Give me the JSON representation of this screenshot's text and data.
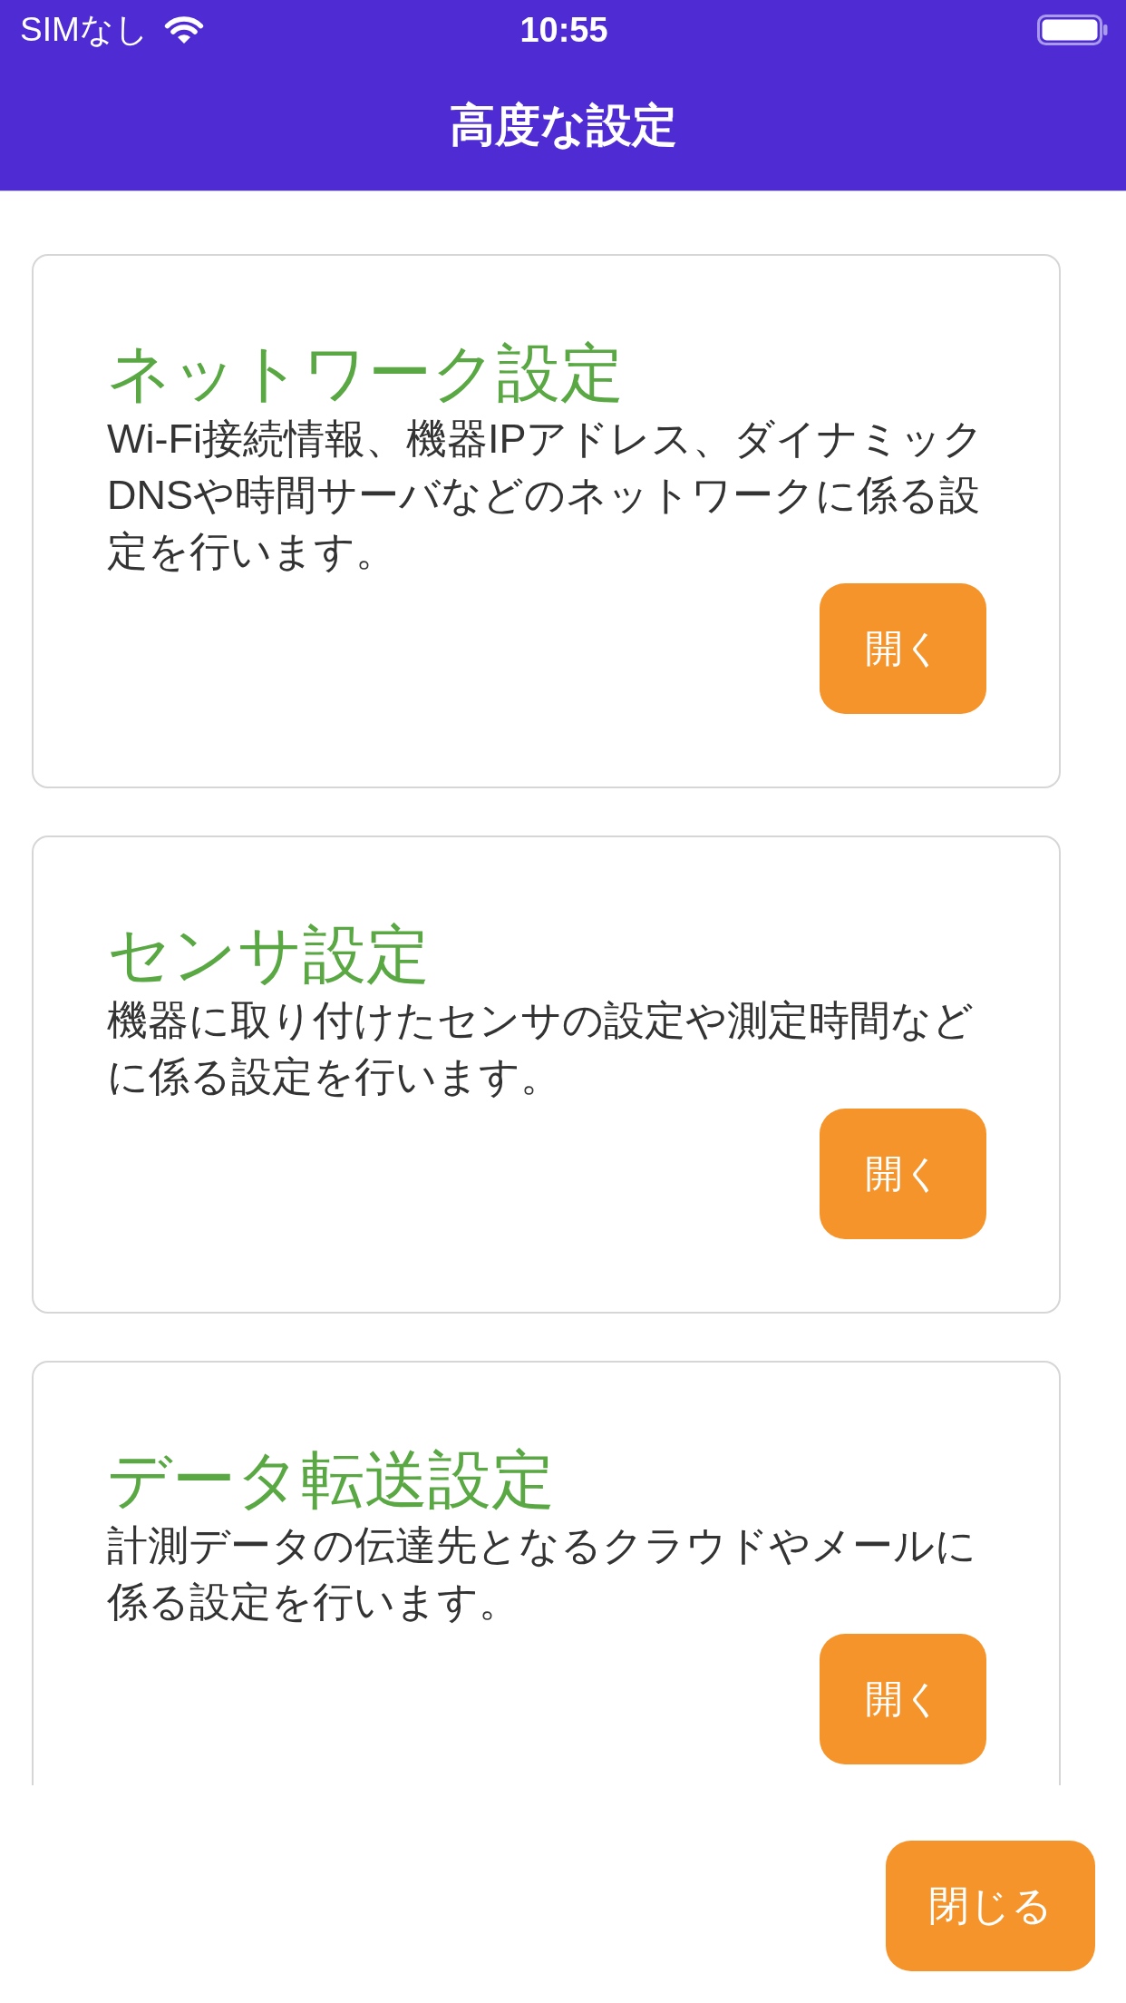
{
  "status_bar": {
    "carrier": "SIMなし",
    "time": "10:55"
  },
  "header": {
    "title": "高度な設定"
  },
  "cards": [
    {
      "title": "ネットワーク設定",
      "description": "Wi-Fi接続情報、機器IPアドレス、ダイナミックDNSや時間サーバなどのネットワークに係る設定を行います。",
      "button": "開く"
    },
    {
      "title": "センサ設定",
      "description": "機器に取り付けたセンサの設定や測定時間などに係る設定を行います。",
      "button": "開く"
    },
    {
      "title": "データ転送設定",
      "description": "計測データの伝達先となるクラウドやメールに係る設定を行います。",
      "button": "開く"
    }
  ],
  "footer": {
    "close_button": "閉じる"
  }
}
